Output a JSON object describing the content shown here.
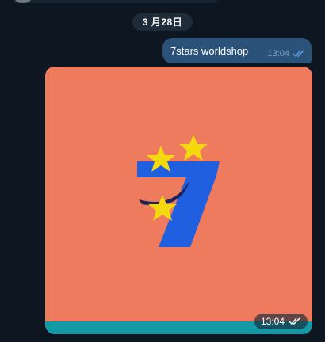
{
  "chat": {
    "date_separator": "3 月28日",
    "messages": [
      {
        "type": "text",
        "text": "7stars worldshop",
        "time": "13:04",
        "status_icon": "double-check-icon"
      },
      {
        "type": "photo",
        "image": "7stars-logo",
        "time": "13:04",
        "status_icon": "double-check-icon"
      }
    ]
  },
  "colors": {
    "chat_background": "#0e1621",
    "outgoing_bubble": "#2b5278",
    "photo_background": "#ef7b5e",
    "logo_seven": "#1f5fe0",
    "logo_star": "#f5d90f",
    "photo_strip": "#149aa4"
  }
}
